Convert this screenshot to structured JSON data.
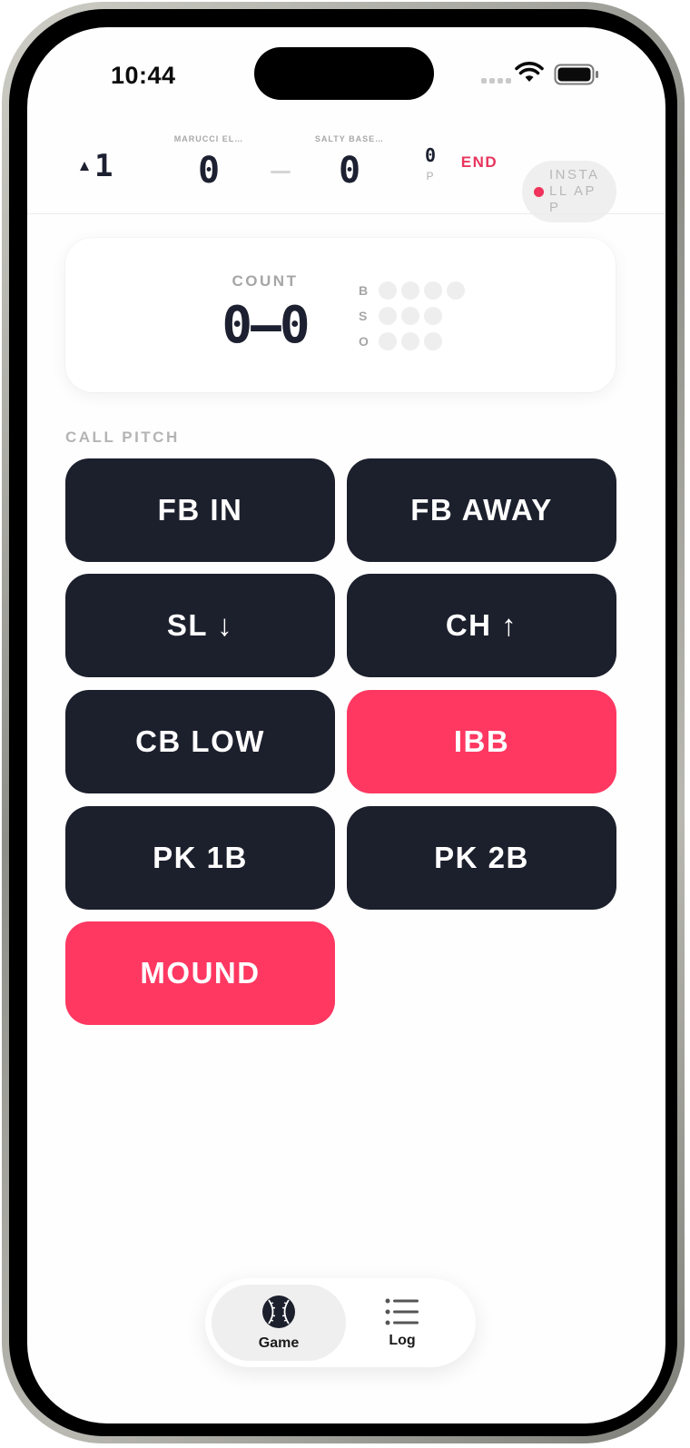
{
  "status_bar": {
    "time": "10:44"
  },
  "header": {
    "inning": "1",
    "away_team": "MARUCCI EL…",
    "away_score": "0",
    "home_team": "SALTY BASE…",
    "home_score": "0",
    "pitch_count": "0",
    "pitch_label": "P",
    "end_label": "END",
    "install_label": "INSTALL APP"
  },
  "count_card": {
    "label": "COUNT",
    "value": "0–0",
    "balls_label": "B",
    "strikes_label": "S",
    "outs_label": "O",
    "balls": 0,
    "strikes": 0,
    "outs": 0
  },
  "call_pitch": {
    "label": "CALL PITCH",
    "buttons": [
      "FB IN",
      "FB AWAY",
      "SL ↓",
      "CH ↑",
      "CB LOW",
      "IBB",
      "PK 1B",
      "PK 2B",
      "MOUND"
    ]
  },
  "colors": {
    "dark_button": "#1c1f2c",
    "accent": "#ff3862",
    "end": "#e8355d"
  },
  "tabbar": {
    "tabs": [
      {
        "label": "Game",
        "icon": "baseball-icon",
        "active": true
      },
      {
        "label": "Log",
        "icon": "list-icon",
        "active": false
      }
    ]
  }
}
